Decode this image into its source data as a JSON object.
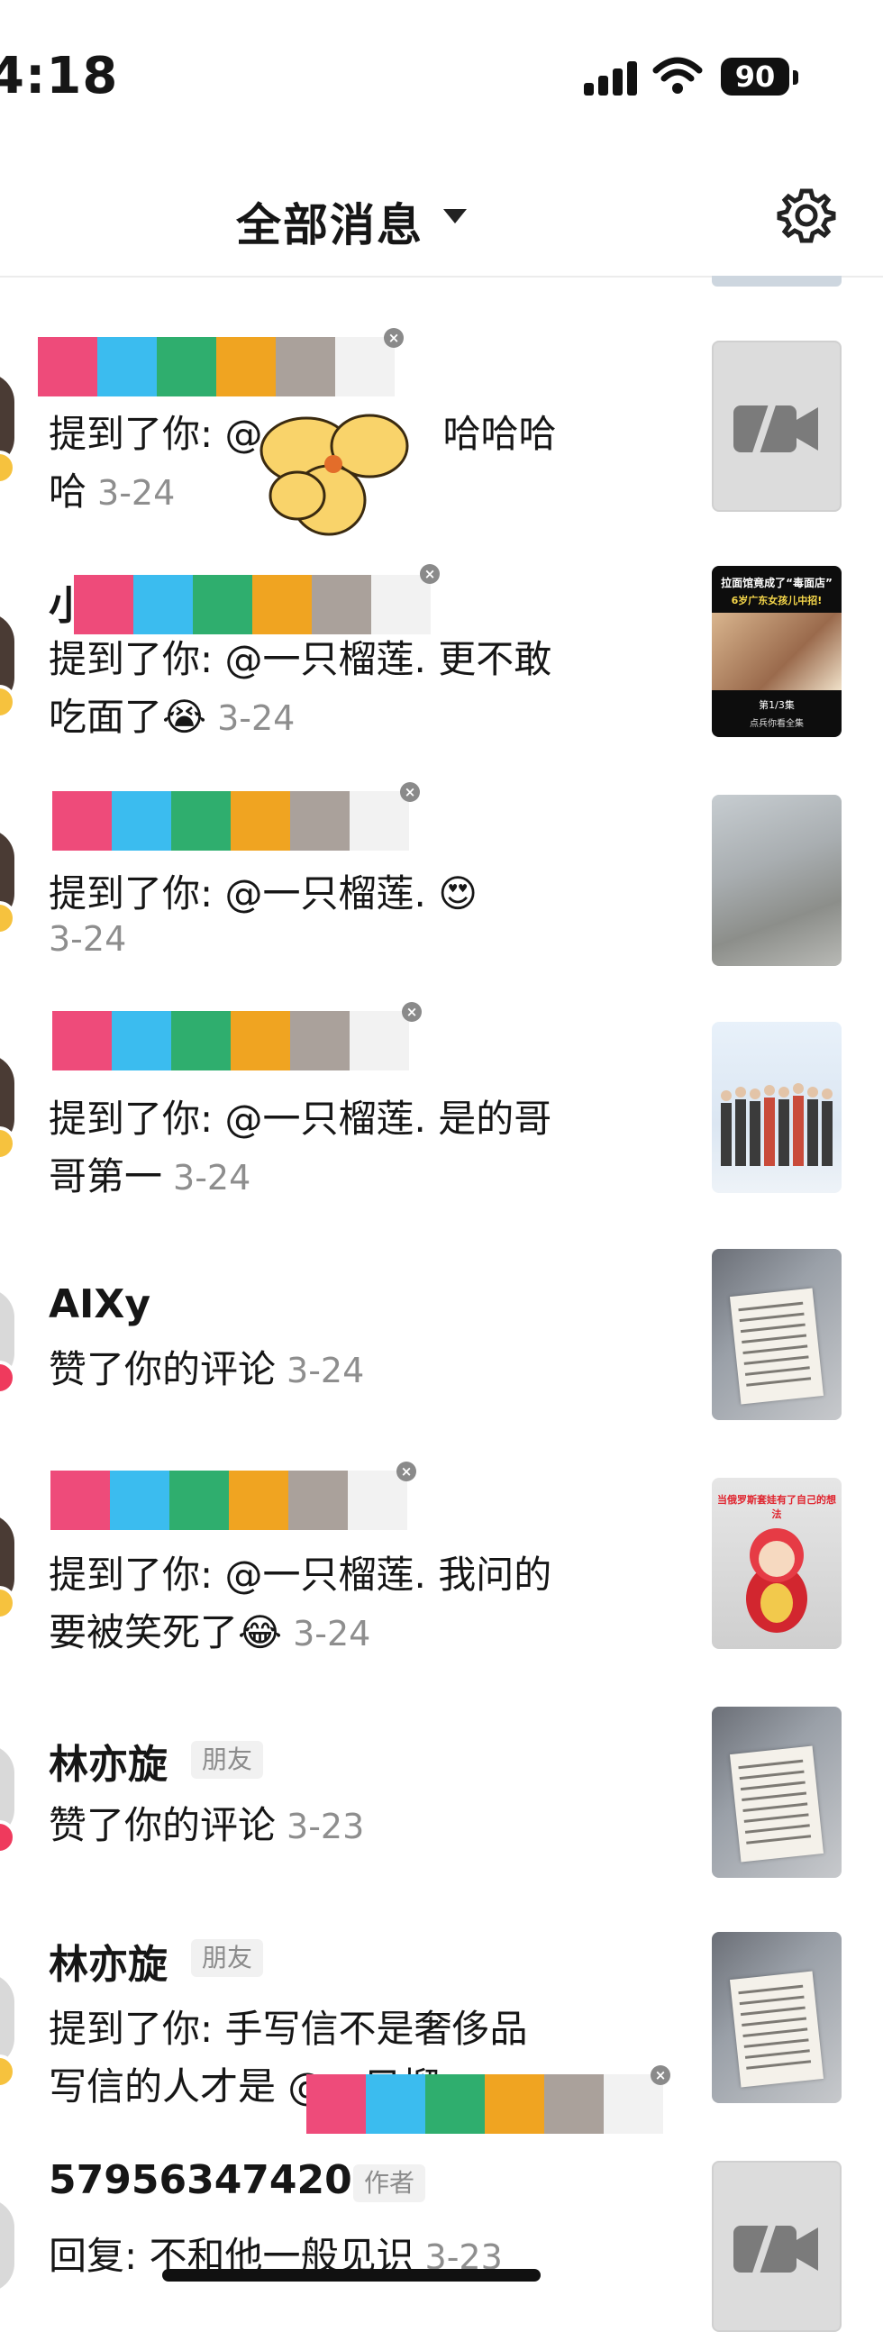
{
  "status_bar": {
    "time": "4:18",
    "battery": "90"
  },
  "header": {
    "title": "全部消息",
    "dropdown_icon": "caret-down-icon",
    "settings_icon": "gear-icon"
  },
  "censor_colors": [
    "#ee4b7a",
    "#3bbcef",
    "#2fae6e",
    "#f0a421",
    "#aaa19b",
    "#f2f2f2"
  ],
  "notifications": [
    {
      "prefix": "提到了你: @",
      "text_after": "哈哈哈",
      "line2": "哈",
      "date": "3-24",
      "thumb": "video-placeholder"
    },
    {
      "name_fragment": "小",
      "prefix": "提到了你: @一只榴莲. 更不敢",
      "line2": "吃面了😭",
      "date": "3-24",
      "thumb": "video",
      "thumb_text": {
        "title": "拉面馆竟成了“毒面店”",
        "subtitle": "6岁广东女孩儿中招!",
        "episode": "第1/3集",
        "cta": "点兵你看全集"
      }
    },
    {
      "prefix": "提到了你: @一只榴莲. 😍",
      "date": "3-24",
      "thumb": "sand"
    },
    {
      "prefix": "提到了你: @一只榴莲. 是的哥",
      "line2": "哥第一",
      "date": "3-24",
      "thumb": "people"
    },
    {
      "name": "AIXy",
      "prefix": "赞了你的评论",
      "date": "3-24",
      "thumb": "paper"
    },
    {
      "prefix": "提到了你: @一只榴莲. 我问的",
      "line2": "要被笑死了😂",
      "date": "3-24",
      "thumb": "doll",
      "thumb_text": {
        "title": "当俄罗斯套娃有了自己的想法"
      }
    },
    {
      "name": "林亦旋",
      "tag": "朋友",
      "prefix": "赞了你的评论",
      "date": "3-23",
      "thumb": "paper"
    },
    {
      "name": "林亦旋",
      "tag": "朋友",
      "prefix": "提到了你: 手写信不是奢侈品",
      "line2": "写信的人才是 @一只榴",
      "thumb": "paper"
    },
    {
      "name": "57956347420",
      "tag": "作者",
      "prefix": "回复: 不和他一般见识",
      "date": "3-23",
      "thumb": "video-placeholder"
    }
  ]
}
